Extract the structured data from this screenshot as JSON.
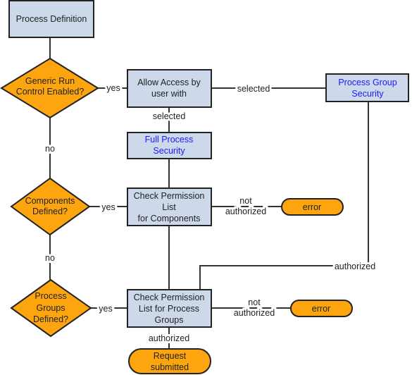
{
  "nodes": {
    "process_definition": [
      "Process Definition"
    ],
    "generic_run_control": [
      "Generic Run",
      "Control Enabled?"
    ],
    "allow_access": [
      "Allow Access by",
      "user with"
    ],
    "full_process_security": [
      "Full Process",
      "Security"
    ],
    "process_group_security": [
      "Process Group",
      "Security"
    ],
    "components_defined": [
      "Components",
      "Defined?"
    ],
    "check_components": [
      "Check Permission",
      "List",
      "for Components"
    ],
    "error_1": [
      "error"
    ],
    "process_groups_defined": [
      "Process",
      "Groups",
      "Defined?"
    ],
    "check_process_groups": [
      "Check Permission",
      "List for Process",
      "Groups"
    ],
    "error_2": [
      "error"
    ],
    "request_submitted": [
      "Request",
      "submitted"
    ]
  },
  "edges": {
    "yes_1": "yes",
    "selected_right": "selected",
    "selected_down": "selected",
    "no_1": "no",
    "yes_2": "yes",
    "not_authorized_1": [
      "not",
      "authorized"
    ],
    "authorized_pgs": "authorized",
    "no_2": "no",
    "yes_3": "yes",
    "not_authorized_2": [
      "not",
      "authorized"
    ],
    "authorized_final": "authorized"
  },
  "colors": {
    "process_box": "#cdd9ea",
    "decision": "#fda50f",
    "link_text": "#1a1aff"
  }
}
